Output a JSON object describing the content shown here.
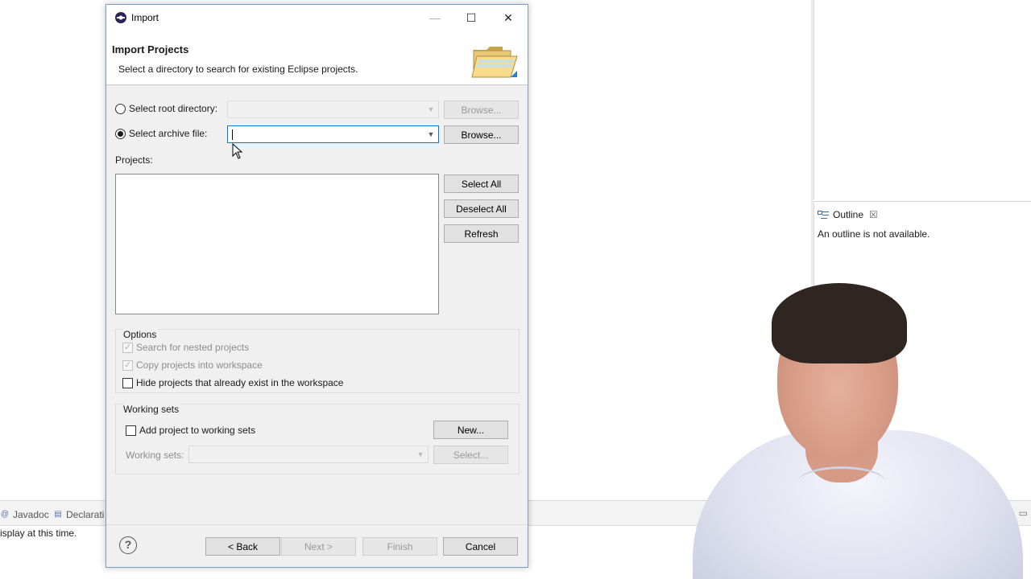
{
  "dialog": {
    "title": "Import",
    "window_buttons": {
      "minimize": "—",
      "maximize": "☐",
      "close": "✕"
    },
    "banner": {
      "title": "Import Projects",
      "description": "Select a directory to search for existing Eclipse projects."
    },
    "root_directory": {
      "label": "Select root directory:",
      "selected": false,
      "value": "",
      "browse": "Browse..."
    },
    "archive_file": {
      "label": "Select archive file:",
      "selected": true,
      "value": "",
      "browse": "Browse..."
    },
    "projects": {
      "label": "Projects:",
      "items": [],
      "select_all": "Select All",
      "deselect_all": "Deselect All",
      "refresh": "Refresh"
    },
    "options": {
      "title": "Options",
      "search_nested": "Search for nested projects",
      "copy_projects": "Copy projects into workspace",
      "hide_existing": "Hide projects that already exist in the workspace"
    },
    "working_sets": {
      "title": "Working sets",
      "add_label": "Add project to working sets",
      "new_button": "New...",
      "sets_label": "Working sets:",
      "select_button": "Select..."
    },
    "footer": {
      "help": "?",
      "back": "< Back",
      "next": "Next >",
      "finish": "Finish",
      "cancel": "Cancel"
    }
  },
  "ide": {
    "outline": {
      "tab_label": "Outline",
      "message": "An outline is not available."
    },
    "bottom": {
      "tabs": [
        "Javadoc",
        "Declarati"
      ],
      "message": "isplay at this time."
    }
  },
  "colors": {
    "dialog_bg": "#f0f0f0",
    "accent": "#0078d7",
    "dialog_border": "#7a9ccd"
  }
}
